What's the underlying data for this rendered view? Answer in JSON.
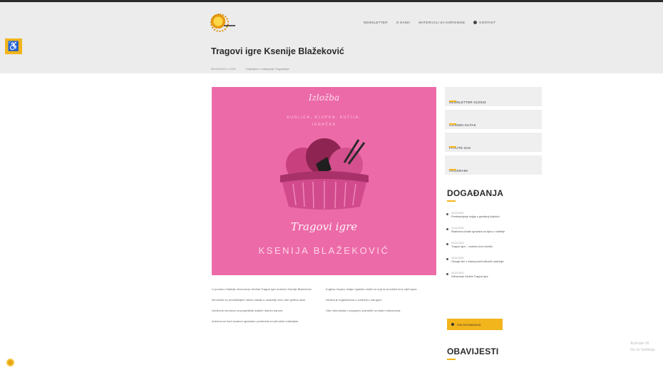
{
  "header": {
    "accessibility_icon": "wheelchair-icon",
    "nav": [
      "NEWSLETTER",
      "O NAMA",
      "MATERIJALI ZA KORISNIKE",
      "KONTAKT"
    ],
    "title": "Tragovi igre Ksenije Blažeković",
    "meta_date": "08.04.2022 u 12:00",
    "meta_info": "Objavljeno u kategoriji: Događanja"
  },
  "hero": {
    "script": "Izložba",
    "sub1": "KUGLICA, KLUPKA, KUTIJA,",
    "sub2": "IGRAČKA",
    "title": "Tragovi igre",
    "name": "KSENIJA BLAŽEKOVIĆ"
  },
  "article": {
    "left": [
      "U prostoru Galerije otvorena je izložba Tragovi igre autorice Ksenije Blažeković.",
      "Na izložbi su predstavljeni radovi nastali u razdoblju kroz više godina rada.",
      "Izložba je otvorena za posjetitelje svakim radnim danom.",
      "Autorica se bavi izradom igračaka i predmeta od prirodnih materijala."
    ],
    "right": [
      "Kuglica, klupko, kutija i igračka motivi su koji se provlače kroz cijeli opus.",
      "Izložba je organizirana u suradnji s udrugom.",
      "Više informacija o programu potražite na našim stranicama."
    ]
  },
  "sidebar": {
    "links": [
      "NEWSLETTER 01/2022",
      "ČLANSKI KUTAK",
      "PITAJTE NAS",
      "PROGRAMI"
    ],
    "events_title": "DOGAĐANJA",
    "events": [
      {
        "date": "10.04.2022",
        "text": "Predstavljanje knjige u gradskoj knjižnici"
      },
      {
        "date": "14.04.2022",
        "text": "Radionica izrade igračaka za djecu i roditelje"
      },
      {
        "date": "20.04.2022",
        "text": "Tragovi igre – vodstvo kroz izložbu"
      },
      {
        "date": "25.04.2022",
        "text": "Okrugli stol o dostupnosti kulturnih sadržaja"
      },
      {
        "date": "30.04.2022",
        "text": "Zatvaranje izložbe Tragovi igre"
      }
    ],
    "more_button": "Sva događanja",
    "notices_title": "OBAVIJESTI"
  },
  "watermark": {
    "line1": "Activate W",
    "line2": "Go to Settings"
  },
  "colors": {
    "accent": "#f2b51b",
    "hero_bg": "#ec6aa8",
    "header_bg": "#ececec"
  }
}
